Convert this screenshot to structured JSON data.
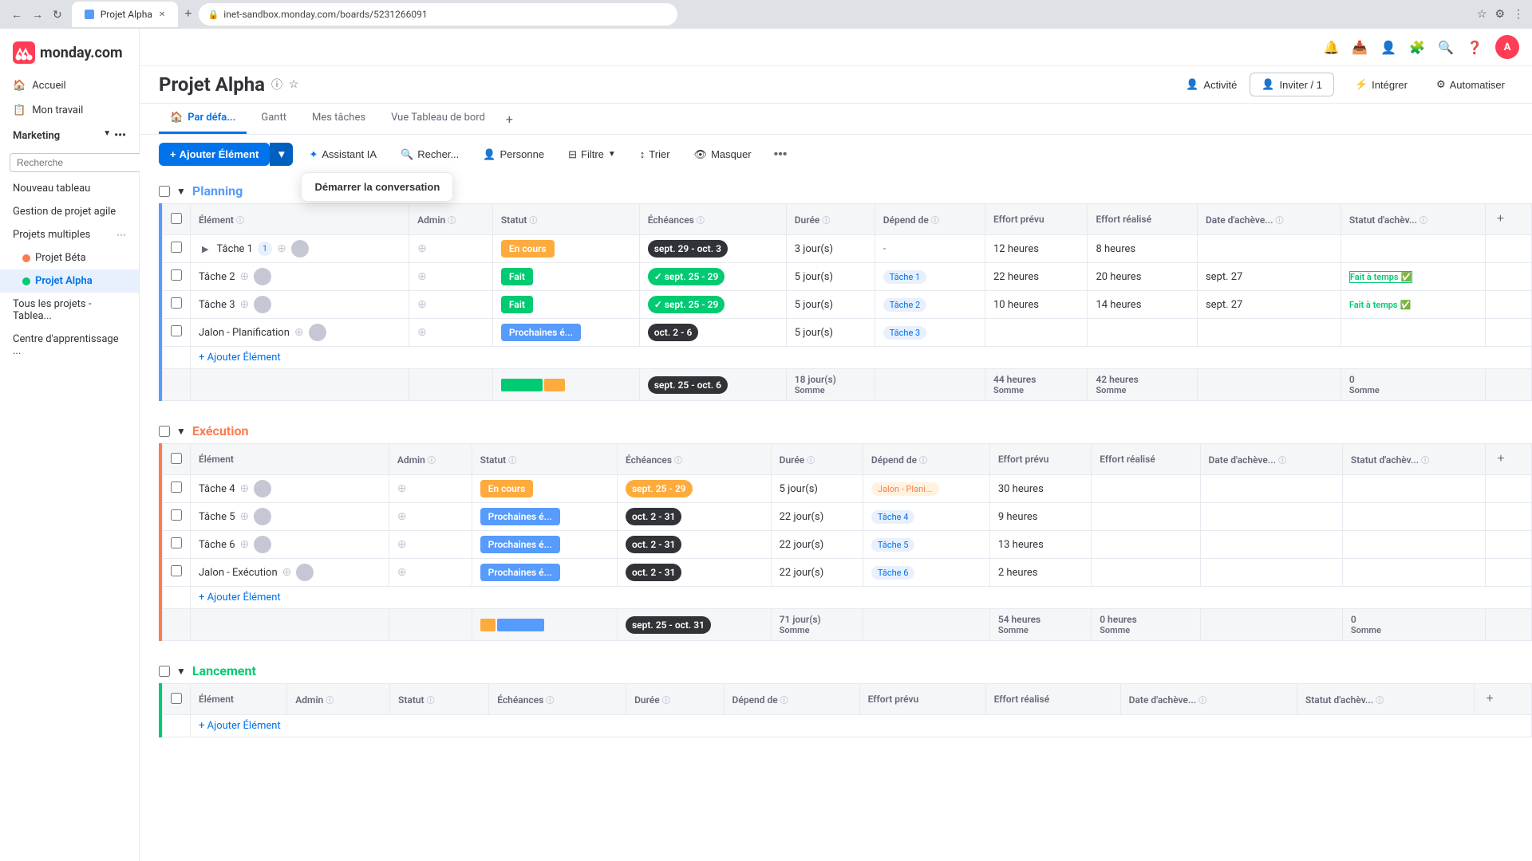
{
  "browser": {
    "tab_title": "Projet Alpha",
    "url": "inet-sandbox.monday.com/boards/5231266091",
    "new_tab_icon": "+"
  },
  "sidebar": {
    "logo_text": "monday.com",
    "nav_items": [
      {
        "label": "Accueil",
        "id": "accueil"
      },
      {
        "label": "Mon travail",
        "id": "mon-travail"
      }
    ],
    "section_label": "Marketing",
    "search_placeholder": "Recherche",
    "list_items": [
      {
        "label": "Nouveau tableau",
        "id": "nouveau-tableau",
        "indent": false,
        "active": false
      },
      {
        "label": "Gestion de projet agile",
        "id": "gestion-projet",
        "indent": false,
        "active": false
      },
      {
        "label": "Projets multiples",
        "id": "projets-multiples",
        "indent": false,
        "active": false
      },
      {
        "label": "Projet Béta",
        "id": "projet-beta",
        "indent": true,
        "active": false
      },
      {
        "label": "Projet Alpha",
        "id": "projet-alpha",
        "indent": true,
        "active": true
      },
      {
        "label": "Tous les projets - Tablea...",
        "id": "tous-projets",
        "indent": false,
        "active": false
      },
      {
        "label": "Centre d'apprentissage ...",
        "id": "centre-apprentissage",
        "indent": false,
        "active": false
      }
    ]
  },
  "header": {
    "page_title": "Projet Alpha",
    "activity_label": "Activité",
    "invite_label": "Inviter / 1",
    "integrer_label": "Intégrer",
    "automatiser_label": "Automatiser"
  },
  "tabs": [
    {
      "label": "Par défa...",
      "active": true,
      "has_home_icon": true
    },
    {
      "label": "Gantt",
      "active": false
    },
    {
      "label": "Mes tâches",
      "active": false
    },
    {
      "label": "Vue Tableau de bord",
      "active": false
    }
  ],
  "toolbar": {
    "add_label": "Ajouter Élément",
    "assistant_label": "Assistant IA",
    "rechercher_label": "Recher...",
    "personne_label": "Personne",
    "filtre_label": "Filtre",
    "trier_label": "Trier",
    "masquer_label": "Masquer"
  },
  "tooltip": {
    "label": "Démarrer la conversation"
  },
  "groups": [
    {
      "id": "planning",
      "title": "Planning",
      "color_class": "group-planning",
      "border_class": "group-border-planning",
      "columns": [
        "Élément",
        "Admin",
        "Statut",
        "Échéances",
        "Durée",
        "Dépend de",
        "Effort prévu",
        "Effort réalisé",
        "Date d'achève...",
        "Statut d'achèv..."
      ],
      "rows": [
        {
          "id": "tache1",
          "label": "Tâche 1",
          "badge": "1",
          "has_expand": true,
          "statut": "En cours",
          "statut_class": "badge-en-cours",
          "echeance": "sept. 29 - oct. 3",
          "echeance_class": "date-dark",
          "duree": "3 jour(s)",
          "depends": "-",
          "effort_prevu": "12 heures",
          "effort_realise": "8 heures",
          "date_achevement": "",
          "statut_achevement": ""
        },
        {
          "id": "tache2",
          "label": "Tâche 2",
          "badge": "",
          "has_expand": false,
          "statut": "Fait",
          "statut_class": "badge-fait",
          "echeance": "sept. 25 - 29",
          "echeance_class": "date-green",
          "duree": "5 jour(s)",
          "depends": "Tâche 1",
          "effort_prevu": "22 heures",
          "effort_realise": "20 heures",
          "date_achevement": "sept. 27",
          "statut_achevement": "Fait à temps"
        },
        {
          "id": "tache3",
          "label": "Tâche 3",
          "badge": "",
          "has_expand": false,
          "statut": "Fait",
          "statut_class": "badge-fait",
          "echeance": "sept. 25 - 29",
          "echeance_class": "date-green",
          "duree": "5 jour(s)",
          "depends": "Tâche 2",
          "effort_prevu": "10 heures",
          "effort_realise": "14 heures",
          "date_achevement": "sept. 27",
          "statut_achevement": "Fait à temps"
        },
        {
          "id": "jalon-planification",
          "label": "Jalon - Planification",
          "badge": "",
          "has_expand": false,
          "statut": "Prochaines é...",
          "statut_class": "badge-prochaines",
          "echeance": "oct. 2 - 6",
          "echeance_class": "date-dark",
          "duree": "5 jour(s)",
          "depends": "Tâche 3",
          "effort_prevu": "",
          "effort_realise": "",
          "date_achevement": "",
          "statut_achevement": ""
        }
      ],
      "summary": {
        "echeance": "sept. 25 - oct. 6",
        "echeance_class": "date-dark",
        "duree": "18 jour(s)",
        "effort_prevu": "44 heures",
        "effort_realise": "42 heures",
        "statut_achevement_val": "0",
        "somme_label": "Somme"
      }
    },
    {
      "id": "execution",
      "title": "Exécution",
      "color_class": "group-execution",
      "border_class": "group-border-execution",
      "columns": [
        "Élément",
        "Admin",
        "Statut",
        "Échéances",
        "Durée",
        "Dépend de",
        "Effort prévu",
        "Effort réalisé",
        "Date d'achève...",
        "Statut d'achèv..."
      ],
      "rows": [
        {
          "id": "tache4",
          "label": "Tâche 4",
          "statut": "En cours",
          "statut_class": "badge-en-cours",
          "echeance": "sept. 25 - 29",
          "echeance_class": "date-orange",
          "duree": "5 jour(s)",
          "depends": "Jalon - Plani...",
          "depends_class": "dep-badge-jalon",
          "effort_prevu": "30 heures",
          "effort_realise": "",
          "date_achevement": "",
          "statut_achevement": ""
        },
        {
          "id": "tache5",
          "label": "Tâche 5",
          "statut": "Prochaines é...",
          "statut_class": "badge-prochaines",
          "echeance": "oct. 2 - 31",
          "echeance_class": "date-dark",
          "duree": "22 jour(s)",
          "depends": "Tâche 4",
          "effort_prevu": "9 heures",
          "effort_realise": "",
          "date_achevement": "",
          "statut_achevement": ""
        },
        {
          "id": "tache6",
          "label": "Tâche 6",
          "statut": "Prochaines é...",
          "statut_class": "badge-prochaines",
          "echeance": "oct. 2 - 31",
          "echeance_class": "date-dark",
          "duree": "22 jour(s)",
          "depends": "Tâche 5",
          "effort_prevu": "13 heures",
          "effort_realise": "",
          "date_achevement": "",
          "statut_achevement": ""
        },
        {
          "id": "jalon-execution",
          "label": "Jalon - Exécution",
          "statut": "Prochaines é...",
          "statut_class": "badge-prochaines",
          "echeance": "oct. 2 - 31",
          "echeance_class": "date-dark",
          "duree": "22 jour(s)",
          "depends": "Tâche 6",
          "effort_prevu": "2 heures",
          "effort_realise": "",
          "date_achevement": "",
          "statut_achevement": ""
        }
      ],
      "summary": {
        "echeance": "sept. 25 - oct. 31",
        "echeance_class": "date-dark",
        "duree": "71 jour(s)",
        "effort_prevu": "54 heures",
        "effort_realise": "0 heures",
        "statut_achevement_val": "0",
        "somme_label": "Somme"
      }
    },
    {
      "id": "lancement",
      "title": "Lancement",
      "color_class": "group-lancement",
      "border_class": "group-border-lancement",
      "columns": [
        "Élément",
        "Admin",
        "Statut",
        "Échéances",
        "Durée",
        "Dépend de",
        "Effort prévu",
        "Effort réalisé",
        "Date d'achève...",
        "Statut d'achèv..."
      ],
      "rows": [],
      "summary": null
    }
  ],
  "labels": {
    "add_element": "+ Ajouter Élément",
    "somme": "Somme",
    "fait_a_temps": "Fait à temps",
    "effort_realise": "Effort realise"
  }
}
